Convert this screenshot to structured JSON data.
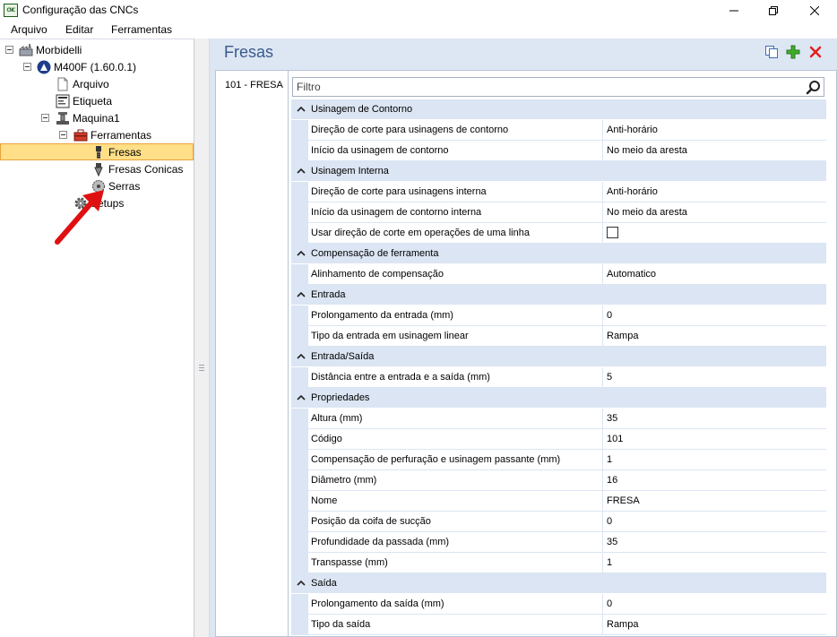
{
  "window": {
    "title": "Configuração das CNCs",
    "app_icon_text": "CNC"
  },
  "menu": {
    "items": [
      "Arquivo",
      "Editar",
      "Ferramentas"
    ]
  },
  "tree": {
    "root": "Morbidelli",
    "machine_model": "M400F (1.60.0.1)",
    "arquivo": "Arquivo",
    "etiqueta": "Etiqueta",
    "maquina": "Maquina1",
    "ferramentas": "Ferramentas",
    "fresas": "Fresas",
    "fresas_conicas": "Fresas Conicas",
    "serras": "Serras",
    "setups": "Setups"
  },
  "panel": {
    "title": "Fresas",
    "tab_label": "101 - FRESA",
    "filter_placeholder": "Filtro"
  },
  "categories": [
    {
      "name": "Usinagem de Contorno",
      "props": [
        {
          "name": "Direção de corte para usinagens de contorno",
          "value": "Anti-horário"
        },
        {
          "name": "Início da usinagem de contorno",
          "value": "No meio da aresta"
        }
      ]
    },
    {
      "name": "Usinagem Interna",
      "props": [
        {
          "name": "Direção de corte para usinagens interna",
          "value": "Anti-horário"
        },
        {
          "name": "Início da usinagem de contorno interna",
          "value": "No meio da aresta"
        },
        {
          "name": "Usar direção de corte em operações de uma linha",
          "value": "",
          "checkbox": true
        }
      ]
    },
    {
      "name": "Compensação de ferramenta",
      "props": [
        {
          "name": "Alinhamento de compensação",
          "value": "Automatico"
        }
      ]
    },
    {
      "name": "Entrada",
      "props": [
        {
          "name": "Prolongamento da entrada (mm)",
          "value": "0"
        },
        {
          "name": "Tipo da entrada em usinagem linear",
          "value": "Rampa"
        }
      ]
    },
    {
      "name": "Entrada/Saída",
      "props": [
        {
          "name": "Distância entre a entrada e a saída (mm)",
          "value": "5"
        }
      ]
    },
    {
      "name": "Propriedades",
      "props": [
        {
          "name": "Altura (mm)",
          "value": "35"
        },
        {
          "name": "Código",
          "value": "101"
        },
        {
          "name": "Compensação de perfuração e usinagem passante (mm)",
          "value": "1"
        },
        {
          "name": "Diâmetro (mm)",
          "value": "16"
        },
        {
          "name": "Nome",
          "value": "FRESA"
        },
        {
          "name": "Posição da coifa de sucção",
          "value": "0"
        },
        {
          "name": "Profundidade da passada (mm)",
          "value": "35"
        },
        {
          "name": "Transpasse (mm)",
          "value": "1"
        }
      ]
    },
    {
      "name": "Saída",
      "props": [
        {
          "name": "Prolongamento da saída (mm)",
          "value": "0"
        },
        {
          "name": "Tipo da saída",
          "value": "Rampa"
        }
      ]
    }
  ],
  "colors": {
    "accent_title": "#3a5a8c",
    "selection_fill": "#ffdf88",
    "selection_border": "#e9a23b",
    "category_bg": "#dbe5f3",
    "annotation_arrow": "#e01010"
  }
}
